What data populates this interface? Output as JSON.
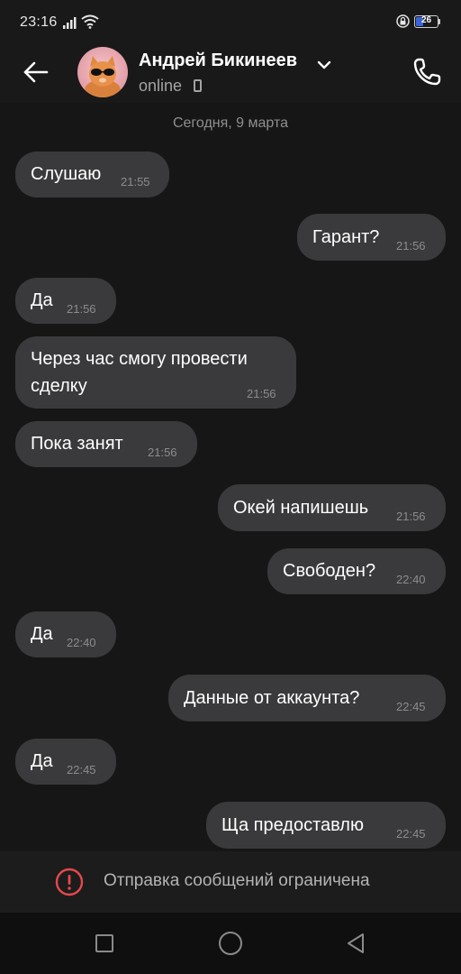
{
  "status_bar": {
    "time": "23:16",
    "battery_level": "26",
    "icons": [
      "signal-icon",
      "wifi-icon",
      "lock-icon",
      "battery-icon"
    ]
  },
  "header": {
    "contact_name": "Андрей Бикинеев",
    "status": "online",
    "icons": [
      "back-arrow-icon",
      "avatar",
      "chevron-down-icon",
      "mobile-device-icon",
      "phone-icon"
    ]
  },
  "chat": {
    "date": "Сегодня, 9 марта",
    "messages": [
      {
        "direction": "incoming",
        "text": "Слушаю",
        "time": "21:55"
      },
      {
        "direction": "outgoing",
        "text": "Гарант?",
        "time": "21:56"
      },
      {
        "direction": "incoming",
        "text": "Да",
        "time": "21:56"
      },
      {
        "direction": "incoming",
        "text_line1": "Через час смогу провести",
        "text_line2": "сделку",
        "time": "21:56"
      },
      {
        "direction": "incoming",
        "text": "Пока занят",
        "time": "21:56"
      },
      {
        "direction": "outgoing",
        "text": "Окей напишешь",
        "time": "21:56"
      },
      {
        "direction": "outgoing",
        "text": "Свободен?",
        "time": "22:40"
      },
      {
        "direction": "incoming",
        "text": "Да",
        "time": "22:40"
      },
      {
        "direction": "outgoing",
        "text": "Данные от аккаунта?",
        "time": "22:45"
      },
      {
        "direction": "incoming",
        "text": "Да",
        "time": "22:45"
      },
      {
        "direction": "outgoing",
        "text": "Ща предоставлю",
        "time": "22:45"
      }
    ]
  },
  "restriction": {
    "text": "Отправка сообщений ограничена",
    "icon": "warning-icon",
    "accent_color": "#e5484d"
  },
  "navbar": {
    "icons": [
      "recent-apps-icon",
      "home-icon",
      "back-icon"
    ]
  },
  "colors": {
    "background": "#161616",
    "bubble": "#3a3a3c",
    "timestamp": "#8c8c8c"
  }
}
